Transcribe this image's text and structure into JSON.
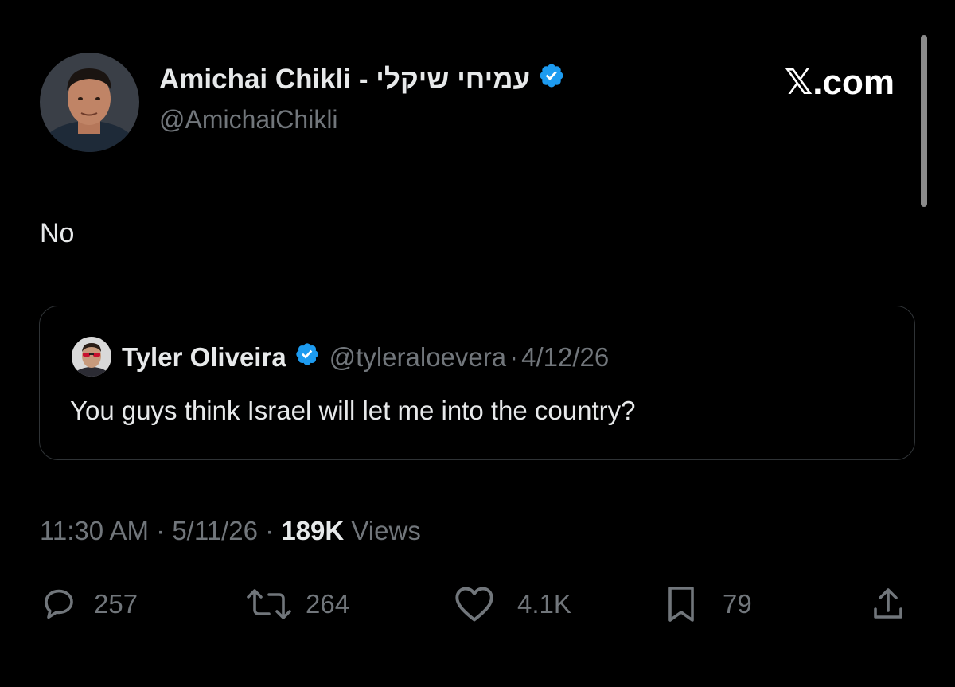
{
  "author": {
    "display_name": "Amichai Chikli - עמיחי שיקלי",
    "handle": "@AmichaiChikli"
  },
  "site": {
    "logo_text": "𝕏.com"
  },
  "tweet": {
    "text": "No",
    "time": "11:30 AM",
    "date": "5/11/26",
    "views_count": "189K",
    "views_label": "Views",
    "meta_sep": "·"
  },
  "quote": {
    "display_name": "Tyler Oliveira",
    "handle": "@tyleraloevera",
    "sep": "·",
    "date": "4/12/26",
    "text": "You guys think Israel will let me into the country?"
  },
  "actions": {
    "replies": "257",
    "reposts": "264",
    "likes": "4.1K",
    "bookmarks": "79"
  },
  "icons": [
    "verified-badge-icon",
    "reply-icon",
    "repost-icon",
    "like-icon",
    "bookmark-icon",
    "share-icon"
  ],
  "colors": {
    "background": "#000000",
    "text_primary": "#e7e9ea",
    "text_secondary": "#71767b",
    "verified_blue": "#1d9bf0",
    "card_border": "#2f3336"
  }
}
